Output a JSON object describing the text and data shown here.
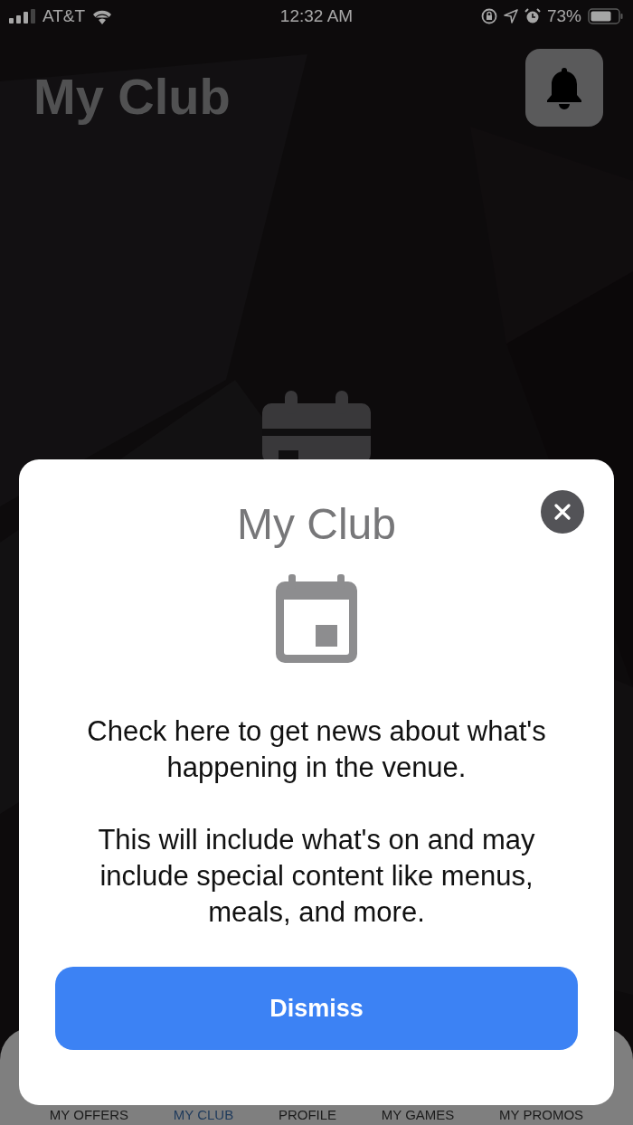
{
  "status_bar": {
    "carrier": "AT&T",
    "time": "12:32 AM",
    "battery": "73%"
  },
  "header": {
    "title": "My Club"
  },
  "tabs": [
    {
      "label": "MY OFFERS",
      "selected": false
    },
    {
      "label": "MY CLUB",
      "selected": true
    },
    {
      "label": "PROFILE",
      "selected": false
    },
    {
      "label": "MY GAMES",
      "selected": false
    },
    {
      "label": "MY PROMOS",
      "selected": false
    }
  ],
  "modal": {
    "title": "My Club",
    "paragraphs": [
      "Check here to get news about what's happening in the venue.",
      "This will include what's on and may include special content like menus, meals, and more."
    ],
    "button": "Dismiss"
  }
}
